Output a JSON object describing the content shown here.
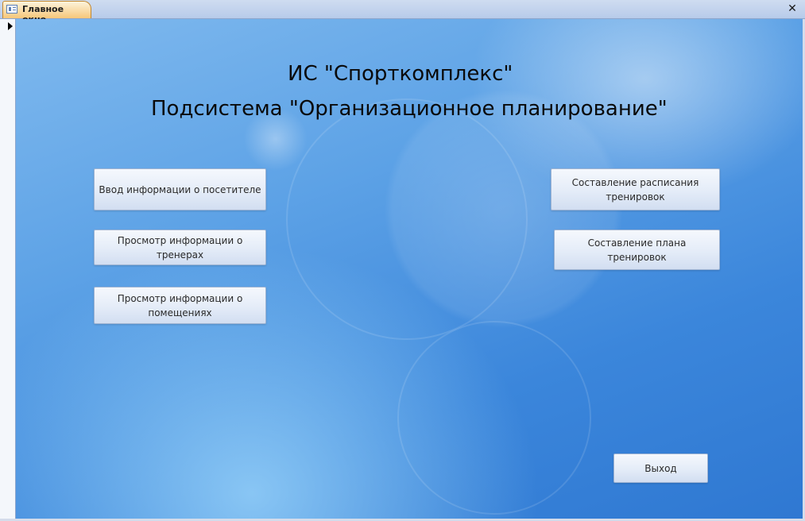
{
  "window": {
    "tab_title": "Главное окно",
    "close_glyph": "✕"
  },
  "form": {
    "title_line1": "ИС \"Спорткомплекс\"",
    "title_line2": "Подсистема \"Организационное планирование\""
  },
  "buttons": {
    "visitor_input": {
      "line1": "Ввод информации о посетителе",
      "line2": ""
    },
    "trainers_view": {
      "line1": "Просмотр информации о",
      "line2": "тренерах"
    },
    "rooms_view": {
      "line1": "Просмотр информации о",
      "line2": "помещениях"
    },
    "schedule": {
      "line1": "Составление расписания",
      "line2": "тренировок"
    },
    "training_plan": {
      "line1": "Составление плана тренировок",
      "line2": ""
    },
    "exit": {
      "line1": "Выход",
      "line2": ""
    }
  },
  "icons": {
    "tab": "form-icon",
    "record_selector": "record-pointer-icon",
    "close": "close-icon"
  }
}
